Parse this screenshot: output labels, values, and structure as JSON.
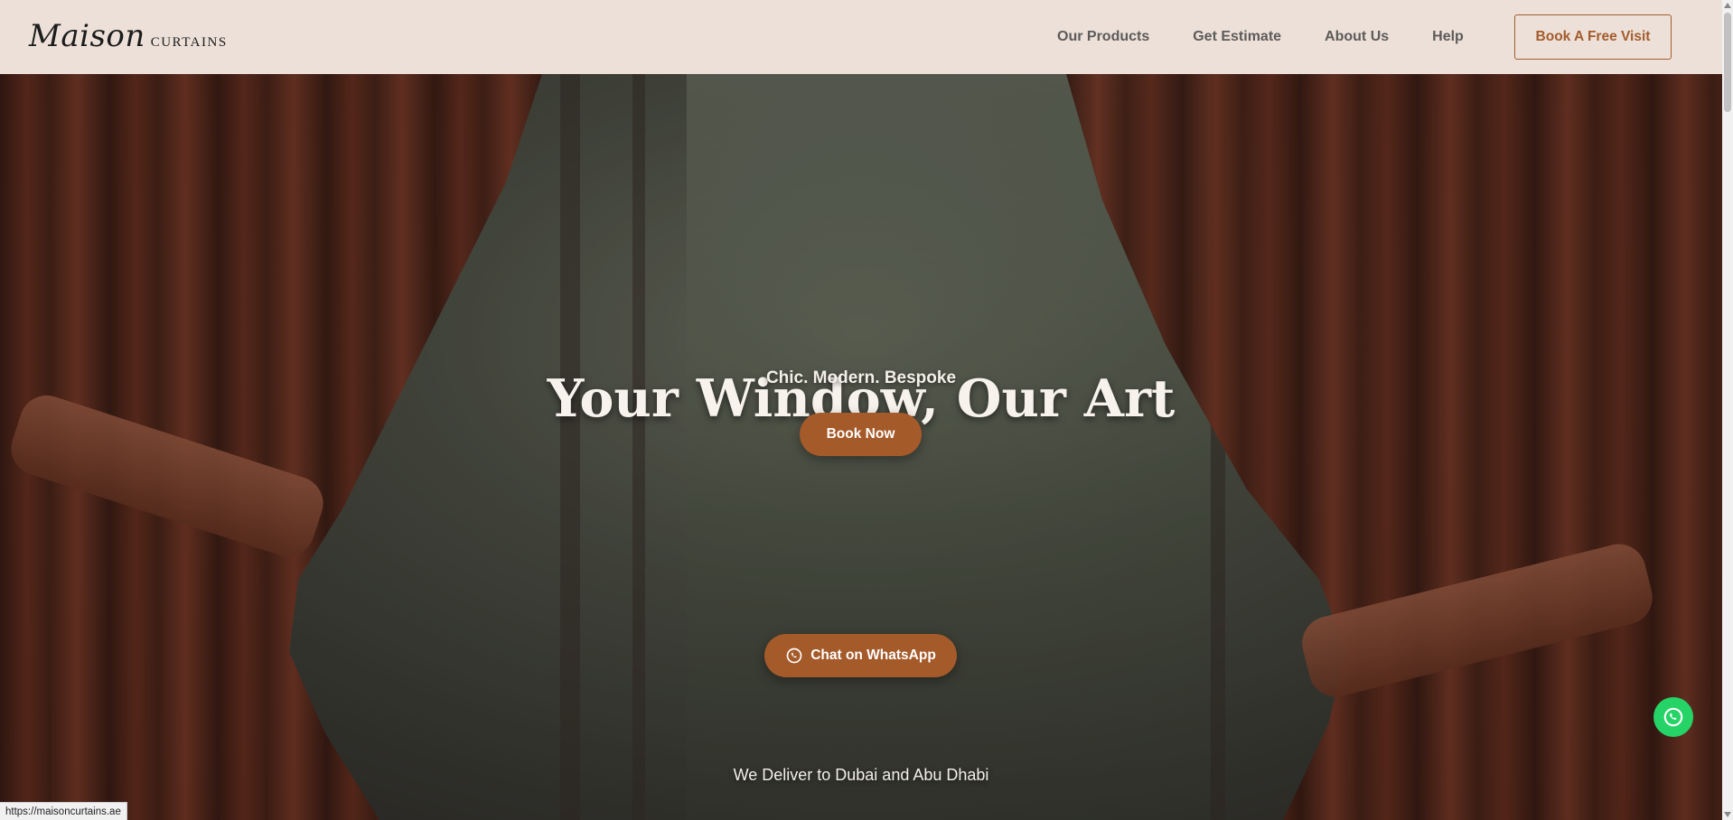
{
  "header": {
    "logo_script": "Maison",
    "logo_word": "CURTAINS",
    "nav": [
      {
        "label": "Our Products"
      },
      {
        "label": "Get Estimate"
      },
      {
        "label": "About Us"
      },
      {
        "label": "Help"
      }
    ],
    "cta_label": "Book A Free Visit"
  },
  "hero": {
    "title": "Your Window, Our Art",
    "subtitle": "Chic. Modern. Bespoke",
    "primary_button": "Book Now",
    "whatsapp_button": "Chat on WhatsApp",
    "delivery_text": "We Deliver to Dubai and Abu Dhabi"
  },
  "status_bar": {
    "url": "https://maisoncurtains.ae"
  },
  "colors": {
    "accent": "#a55a2a",
    "header_bg": "#ece0d8",
    "whatsapp_green": "#25d366"
  },
  "icons": {
    "whatsapp_inline": "whatsapp-icon",
    "whatsapp_float": "whatsapp-icon"
  }
}
